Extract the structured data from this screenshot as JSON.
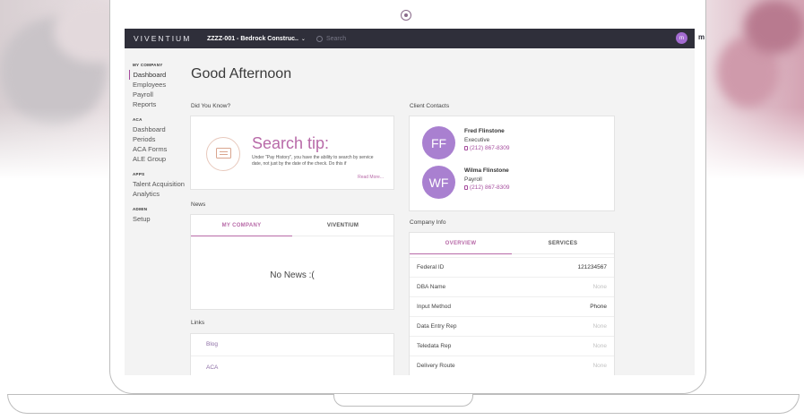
{
  "header": {
    "logo": "VIVENTIUM",
    "client_selector": "ZZZZ-001 - Bedrock Construc..",
    "search_placeholder": "Search",
    "user_initial": "m",
    "user_label": "m"
  },
  "sidebar": {
    "sections": [
      {
        "title": "MY COMPANY",
        "items": [
          "Dashboard",
          "Employees",
          "Payroll",
          "Reports"
        ]
      },
      {
        "title": "ACA",
        "items": [
          "Dashboard",
          "Periods",
          "ACA Forms",
          "ALE Group"
        ]
      },
      {
        "title": "APPS",
        "items": [
          "Talent Acquisition",
          "Analytics"
        ]
      },
      {
        "title": "ADMIN",
        "items": [
          "Setup"
        ]
      }
    ]
  },
  "main": {
    "greeting": "Good Afternoon",
    "did_you_know": {
      "title": "Did You Know?",
      "tip_title": "Search tip:",
      "tip_text": "Under \"Pay History\", you have the ability to search by service date, not just by the date of the check. Do this if",
      "read_more": "Read More..."
    },
    "news": {
      "title": "News",
      "tabs": [
        "MY COMPANY",
        "VIVENTIUM"
      ],
      "empty": "No News :("
    },
    "links": {
      "title": "Links",
      "items": [
        "Blog",
        "ACA"
      ]
    },
    "client_contacts": {
      "title": "Client Contacts",
      "contacts": [
        {
          "initials": "FF",
          "name": "Fred Flinstone",
          "role": "Executive",
          "phone": "(212) 867-8309"
        },
        {
          "initials": "WF",
          "name": "Wilma Flinstone",
          "role": "Payroll",
          "phone": "(212) 867-8309"
        }
      ]
    },
    "company_info": {
      "title": "Company Info",
      "tabs": [
        "OVERVIEW",
        "SERVICES"
      ],
      "rows": [
        {
          "label": "Federal ID",
          "value": "121234567"
        },
        {
          "label": "DBA Name",
          "value": "None"
        },
        {
          "label": "Input Method",
          "value": "Phone"
        },
        {
          "label": "Data Entry Rep",
          "value": "None"
        },
        {
          "label": "Teledata Rep",
          "value": "None"
        },
        {
          "label": "Delivery Route",
          "value": "None"
        }
      ]
    }
  },
  "colors": {
    "accent": "#b86aa8",
    "topbar": "#2f2f3a",
    "avatar": "#a980d0"
  }
}
